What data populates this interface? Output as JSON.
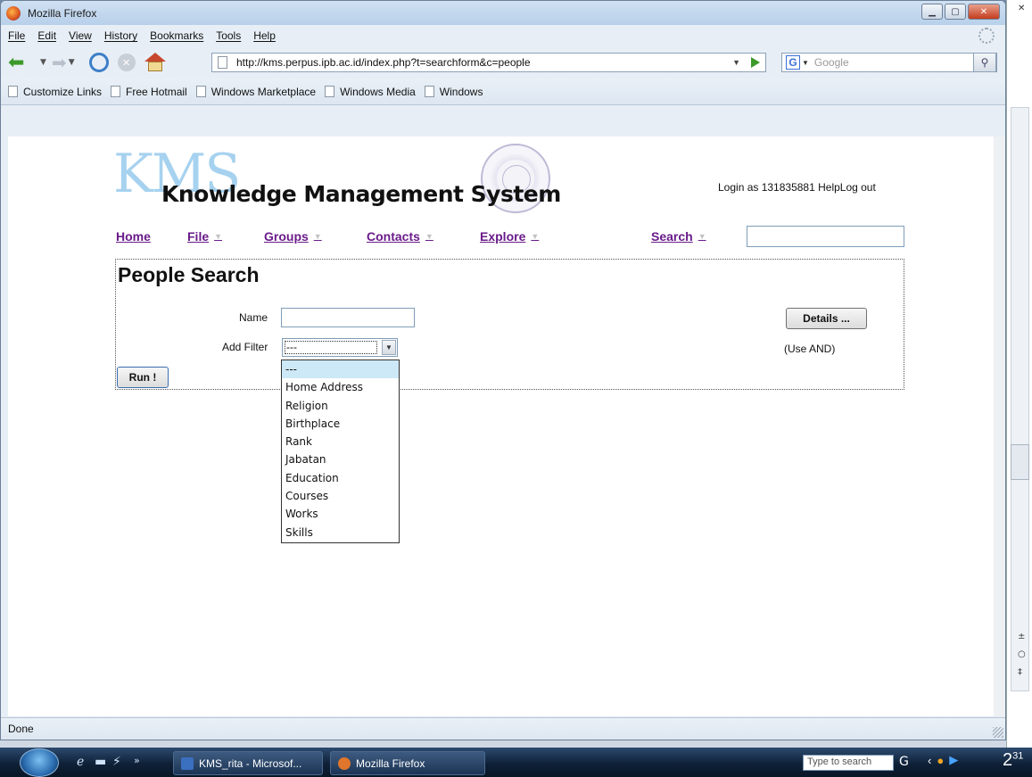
{
  "window": {
    "title": "Mozilla Firefox"
  },
  "menubar": {
    "items": [
      "File",
      "Edit",
      "View",
      "History",
      "Bookmarks",
      "Tools",
      "Help"
    ]
  },
  "navbar": {
    "url": "http://kms.perpus.ipb.ac.id/index.php?t=searchform&c=people",
    "search_placeholder": "Google"
  },
  "links": [
    "Customize Links",
    "Free Hotmail",
    "Windows Marketplace",
    "Windows Media",
    "Windows"
  ],
  "site": {
    "logo_text": "KMS",
    "title": "Knowledge Management System",
    "login_text": "Login as 131835881 HelpLog out",
    "nav": [
      "Home",
      "File",
      "Groups",
      "Contacts",
      "Explore",
      "Search"
    ]
  },
  "form": {
    "heading": "People Search",
    "name_label": "Name",
    "filter_label": "Add Filter",
    "filter_value": "---",
    "details_button": "Details ...",
    "use_and": "(Use AND)",
    "run_button": "Run !",
    "filter_options": [
      "---",
      "Home Address",
      "Religion",
      "Birthplace",
      "Rank",
      "Jabatan",
      "Education",
      "Courses",
      "Works",
      "Skills"
    ]
  },
  "status": {
    "text": "Done"
  },
  "taskbar": {
    "items": [
      "KMS_rita - Microsof...",
      "Mozilla Firefox"
    ],
    "search_placeholder": "Type to search",
    "clock_main": "2",
    "clock_sup": "31"
  },
  "colors": {
    "link_purple": "#6a1b8a",
    "logo_blue": "#a6d2ef",
    "selected_option": "#cde8f6"
  }
}
